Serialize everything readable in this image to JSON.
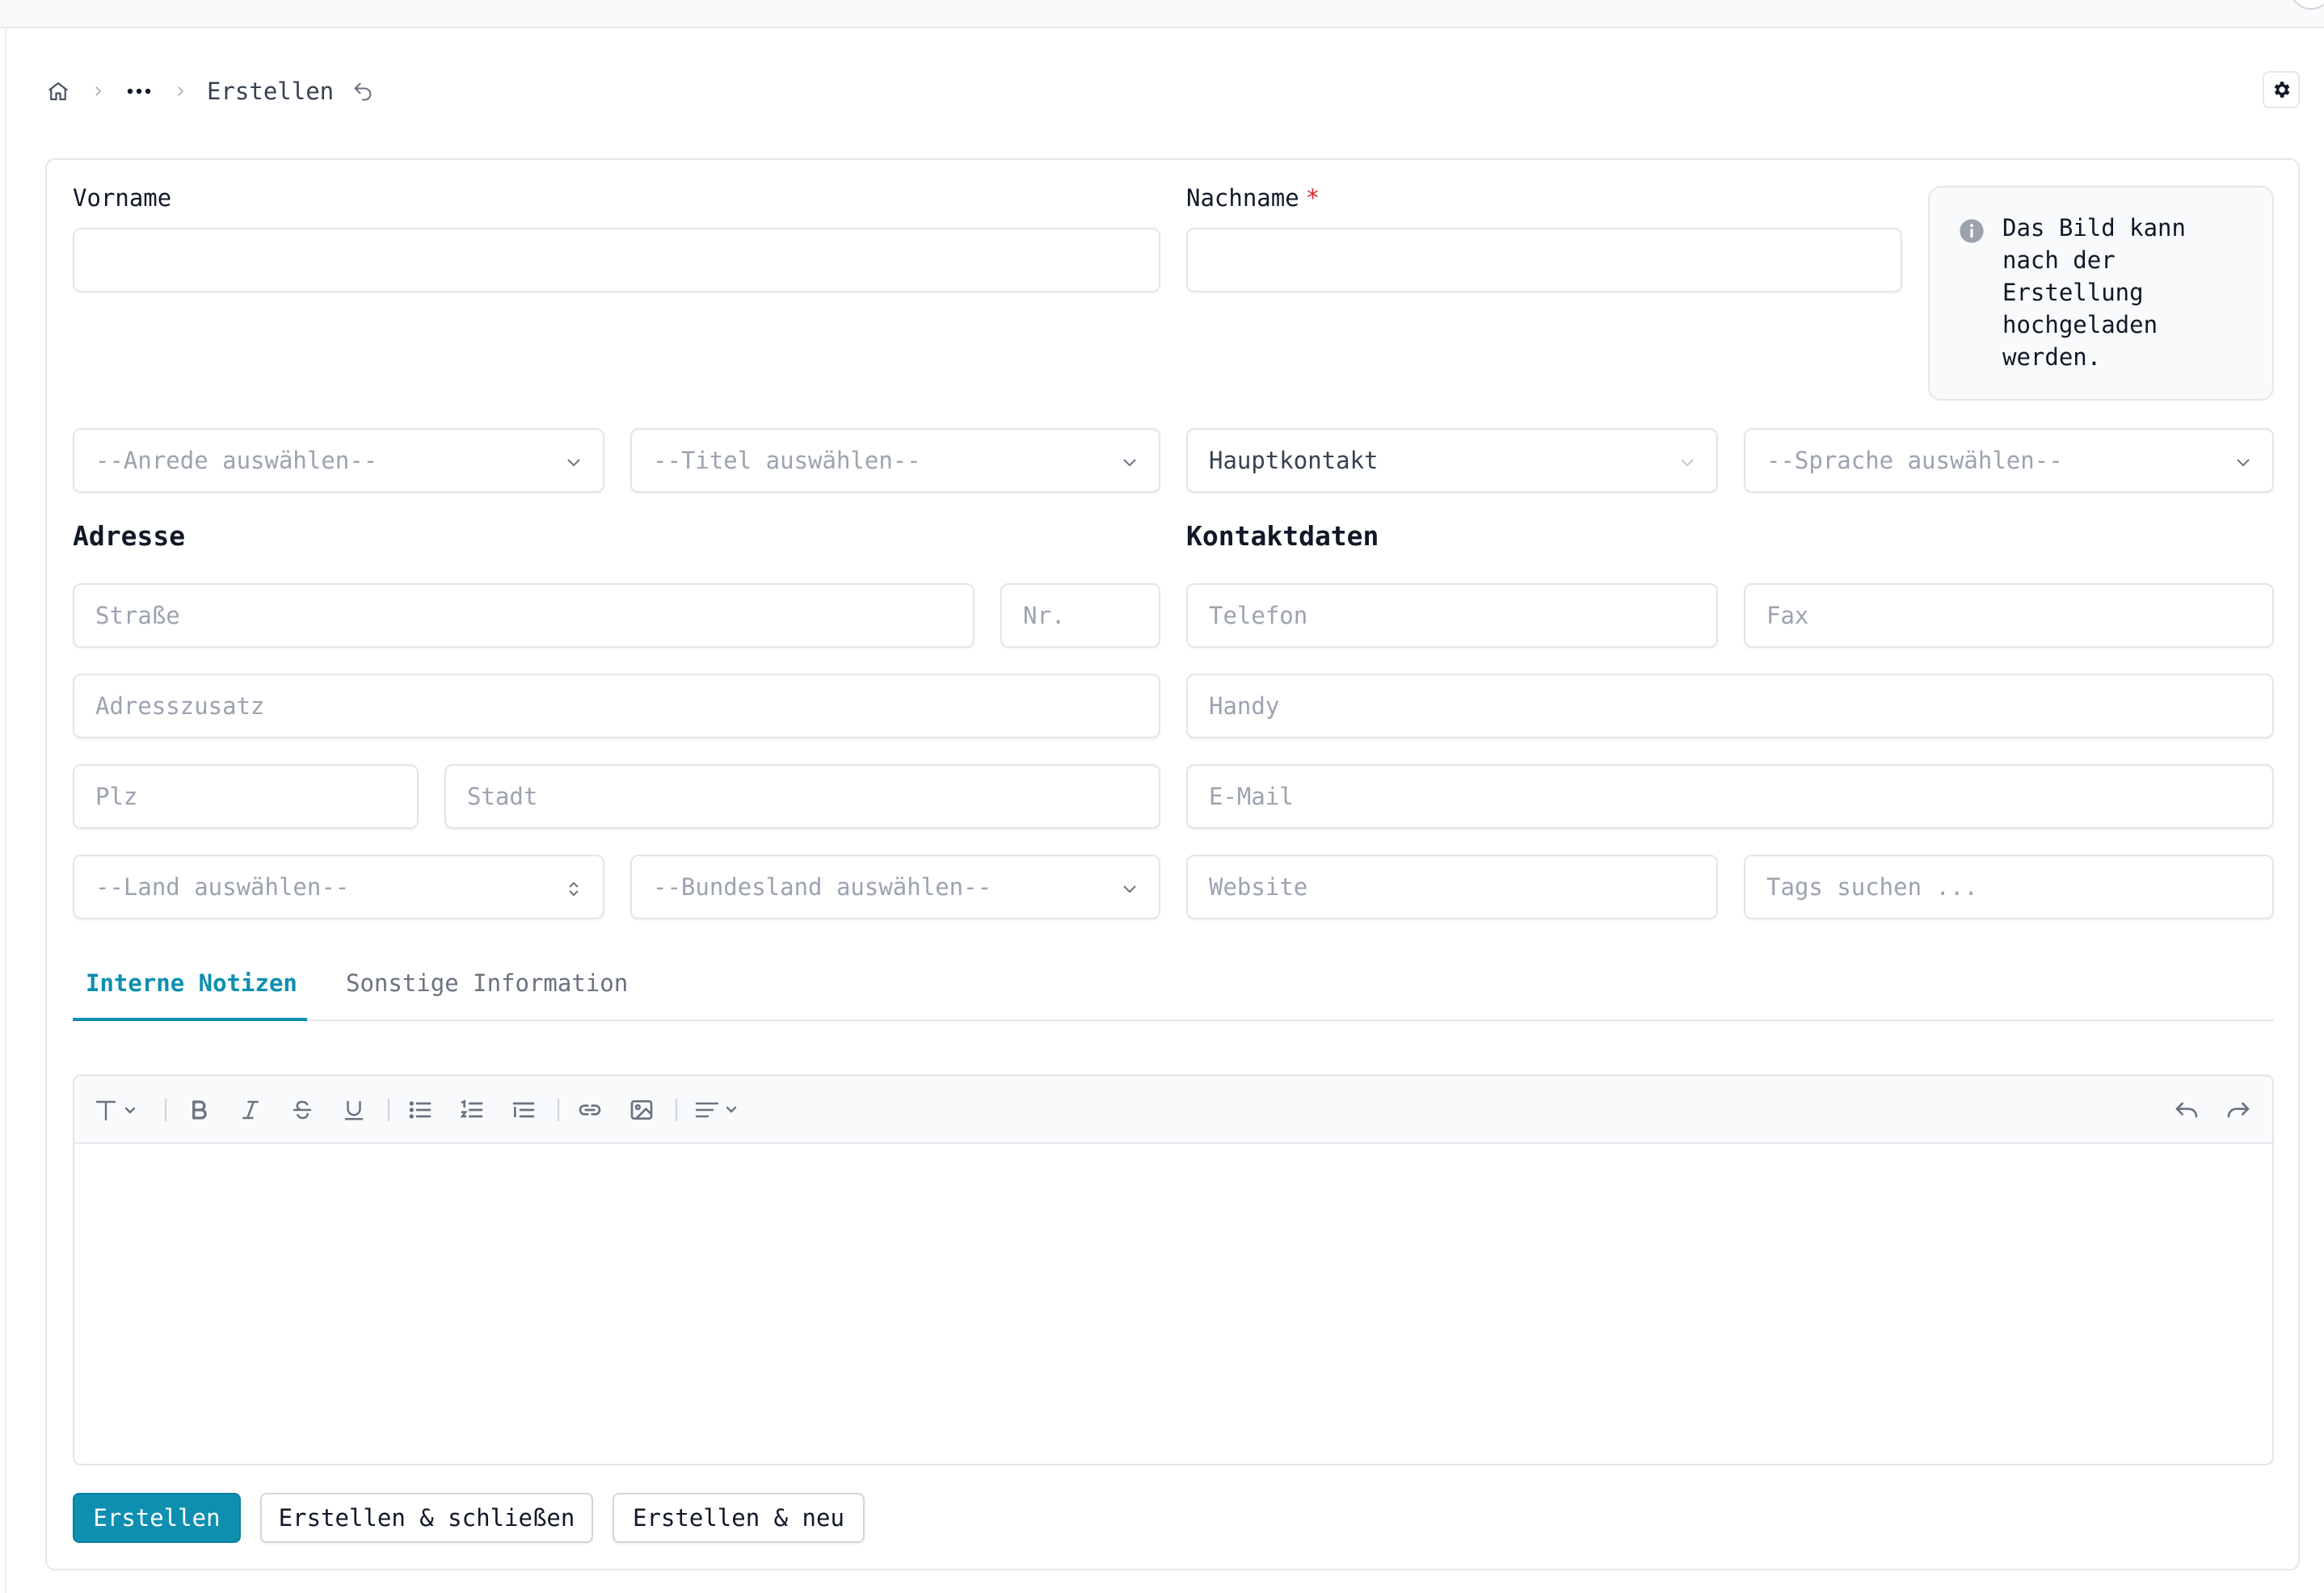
{
  "breadcrumb": {
    "current": "Erstellen"
  },
  "form": {
    "vorname_label": "Vorname",
    "nachname_label": "Nachname",
    "required_mark": "*",
    "info_text": "Das Bild kann\nnach der\nErstellung\nhochgeladen\nwerden.",
    "anrede": "--Anrede auswählen--",
    "titel": "--Titel auswählen--",
    "kontakttyp": "Hauptkontakt",
    "sprache": "--Sprache auswählen--"
  },
  "address": {
    "heading": "Adresse",
    "strasse": "Straße",
    "nr": "Nr.",
    "adresszusatz": "Adresszusatz",
    "plz": "Plz",
    "stadt": "Stadt",
    "land": "--Land auswählen--",
    "bundesland": "--Bundesland auswählen--"
  },
  "contact": {
    "heading": "Kontaktdaten",
    "telefon": "Telefon",
    "fax": "Fax",
    "handy": "Handy",
    "email": "E-Mail",
    "website": "Website",
    "tags": "Tags suchen ..."
  },
  "tabs": [
    {
      "label": "Interne Notizen",
      "active": true
    },
    {
      "label": "Sonstige Information",
      "active": false
    }
  ],
  "editor": {
    "toolbar_icons": [
      "text-style-icon",
      "bold-icon",
      "italic-icon",
      "strikethrough-icon",
      "underline-icon",
      "bullet-list-icon",
      "ordered-list-icon",
      "indent-list-icon",
      "link-icon",
      "image-icon",
      "align-icon",
      "undo-icon",
      "redo-icon"
    ],
    "content": ""
  },
  "buttons": {
    "create": "Erstellen",
    "create_close": "Erstellen & schließen",
    "create_new": "Erstellen & neu"
  },
  "colors": {
    "accent": "#0e8fb0",
    "required": "#dc2626",
    "border": "#e2e5ea"
  }
}
